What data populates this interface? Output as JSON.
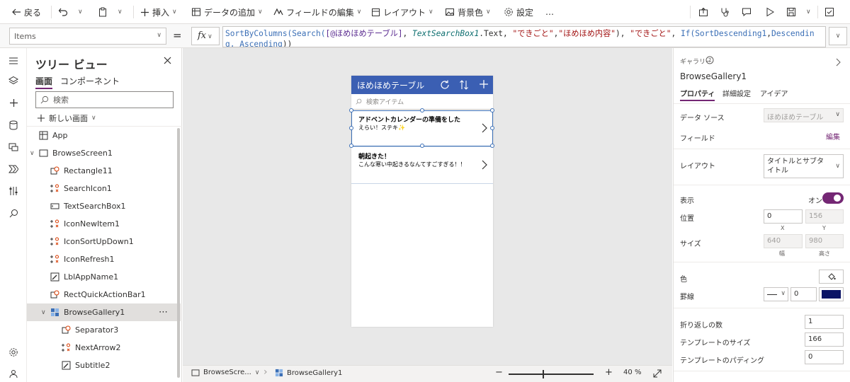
{
  "toolbar": {
    "back": "戻る",
    "insert": "挿入",
    "add_data": "データの追加",
    "edit_fields": "フィールドの編集",
    "layout": "レイアウト",
    "background": "背景色",
    "settings": "設定",
    "more": "…"
  },
  "formula_bar": {
    "property": "Items",
    "equals": "=",
    "fx": "fx",
    "formula": [
      "SortByColumns(",
      "Search(",
      "[@ほめほめテーブル]",
      ", ",
      "TextSearchBox1",
      ".Text, ",
      "\"できごと\"",
      ",",
      "\"ほめほめ内容\"",
      "), ",
      "\"できごと\"",
      ", ",
      "If(",
      "SortDescending1",
      ",",
      "Descending, Ascending",
      "))"
    ]
  },
  "tree": {
    "title": "ツリー ビュー",
    "tab_screens": "画面",
    "tab_components": "コンポーネント",
    "search_placeholder": "検索",
    "new_screen": "新しい画面",
    "items": [
      {
        "label": "App",
        "level": 0,
        "icon": "app-icon"
      },
      {
        "label": "BrowseScreen1",
        "level": 0,
        "icon": "screen-icon",
        "expanded": true
      },
      {
        "label": "Rectangle11",
        "level": 1,
        "icon": "shape-icon"
      },
      {
        "label": "SearchIcon1",
        "level": 1,
        "icon": "icon-control-icon"
      },
      {
        "label": "TextSearchBox1",
        "level": 1,
        "icon": "textinput-icon"
      },
      {
        "label": "IconNewItem1",
        "level": 1,
        "icon": "icon-control-icon"
      },
      {
        "label": "IconSortUpDown1",
        "level": 1,
        "icon": "icon-control-icon"
      },
      {
        "label": "IconRefresh1",
        "level": 1,
        "icon": "icon-control-icon"
      },
      {
        "label": "LblAppName1",
        "level": 1,
        "icon": "label-icon"
      },
      {
        "label": "RectQuickActionBar1",
        "level": 1,
        "icon": "shape-icon"
      },
      {
        "label": "BrowseGallery1",
        "level": 1,
        "icon": "gallery-icon",
        "expanded": true,
        "selected": true,
        "more": "⋯"
      },
      {
        "label": "Separator3",
        "level": 2,
        "icon": "shape-icon"
      },
      {
        "label": "NextArrow2",
        "level": 2,
        "icon": "icon-control-icon"
      },
      {
        "label": "Subtitle2",
        "level": 2,
        "icon": "label-icon"
      }
    ]
  },
  "app": {
    "title": "ほめほめテーブル",
    "search_placeholder": "検索アイテム",
    "items": [
      {
        "title": "アドベントカレンダーの準備をした",
        "subtitle": "えらい！ステキ✨"
      },
      {
        "title": "朝起きた！",
        "subtitle": "こんな寒い中起きるなんてすごすぎる！！"
      }
    ]
  },
  "bottom": {
    "screen": "BrowseScre...",
    "control": "BrowseGallery1",
    "zoom_value": "40",
    "zoom_unit": "%",
    "minus": "−",
    "plus": "+"
  },
  "properties": {
    "type_label": "ギャラリー",
    "control_name": "BrowseGallery1",
    "tabs": [
      "プロパティ",
      "詳細設定",
      "アイデア"
    ],
    "data_source_label": "データ ソース",
    "data_source_value": "ほめほめテーブル",
    "fields_label": "フィールド",
    "fields_edit": "編集",
    "layout_label": "レイアウト",
    "layout_value": "タイトルとサブタイトル",
    "visible_label": "表示",
    "visible_value": "オン",
    "position_label": "位置",
    "x": "0",
    "y": "156",
    "x_caption": "X",
    "y_caption": "Y",
    "size_label": "サイズ",
    "width": "640",
    "height": "980",
    "width_caption": "幅",
    "height_caption": "高さ",
    "color_label": "色",
    "border_label": "罫線",
    "border_width": "0",
    "border_color": "#0b1466",
    "wrap_label": "折り返しの数",
    "wrap_value": "1",
    "template_size_label": "テンプレートのサイズ",
    "template_size_value": "166",
    "template_padding_label": "テンプレートのパディング",
    "template_padding_value": "0"
  },
  "colors": {
    "accent": "#742774",
    "app_header": "#3b5fb3",
    "selection": "#3b6fb6"
  }
}
